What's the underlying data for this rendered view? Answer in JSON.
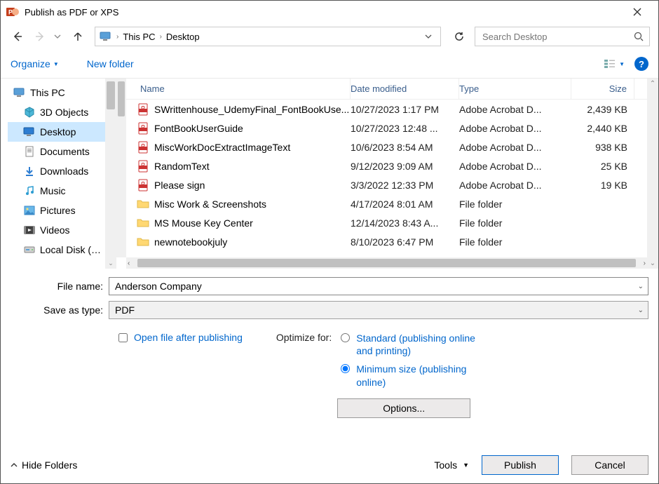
{
  "title": "Publish as PDF or XPS",
  "breadcrumb": {
    "root": "This PC",
    "folder": "Desktop"
  },
  "search": {
    "placeholder": "Search Desktop"
  },
  "toolbar": {
    "organize": "Organize",
    "newfolder": "New folder"
  },
  "sidebar": {
    "items": [
      {
        "label": "This PC",
        "icon": "pc"
      },
      {
        "label": "3D Objects",
        "icon": "3d"
      },
      {
        "label": "Desktop",
        "icon": "desktop",
        "selected": true
      },
      {
        "label": "Documents",
        "icon": "doc"
      },
      {
        "label": "Downloads",
        "icon": "down"
      },
      {
        "label": "Music",
        "icon": "music"
      },
      {
        "label": "Pictures",
        "icon": "pic"
      },
      {
        "label": "Videos",
        "icon": "vid"
      },
      {
        "label": "Local Disk (C:)",
        "icon": "disk"
      }
    ]
  },
  "columns": {
    "name": "Name",
    "date": "Date modified",
    "type": "Type",
    "size": "Size"
  },
  "files": [
    {
      "icon": "pdf",
      "name": "SWrittenhouse_UdemyFinal_FontBookUse...",
      "date": "10/27/2023 1:17 PM",
      "type": "Adobe Acrobat D...",
      "size": "2,439 KB"
    },
    {
      "icon": "pdf",
      "name": "FontBookUserGuide",
      "date": "10/27/2023 12:48 ...",
      "type": "Adobe Acrobat D...",
      "size": "2,440 KB"
    },
    {
      "icon": "pdf",
      "name": "MiscWorkDocExtractImageText",
      "date": "10/6/2023 8:54 AM",
      "type": "Adobe Acrobat D...",
      "size": "938 KB"
    },
    {
      "icon": "pdf",
      "name": "RandomText",
      "date": "9/12/2023 9:09 AM",
      "type": "Adobe Acrobat D...",
      "size": "25 KB"
    },
    {
      "icon": "pdf",
      "name": "Please sign",
      "date": "3/3/2022 12:33 PM",
      "type": "Adobe Acrobat D...",
      "size": "19 KB"
    },
    {
      "icon": "folder",
      "name": "Misc Work & Screenshots",
      "date": "4/17/2024 8:01 AM",
      "type": "File folder",
      "size": ""
    },
    {
      "icon": "folder",
      "name": "MS Mouse Key Center",
      "date": "12/14/2023 8:43 A...",
      "type": "File folder",
      "size": ""
    },
    {
      "icon": "folder",
      "name": "newnotebookjuly",
      "date": "8/10/2023 6:47 PM",
      "type": "File folder",
      "size": ""
    }
  ],
  "form": {
    "filename_label": "File name:",
    "filename_value": "Anderson Company",
    "saveas_label": "Save as type:",
    "saveas_value": "PDF",
    "open_after": "Open file after publishing",
    "optimize_label": "Optimize for:",
    "opt_standard": "Standard (publishing online and printing)",
    "opt_minimum": "Minimum size (publishing online)",
    "options_btn": "Options..."
  },
  "bottom": {
    "hide": "Hide Folders",
    "tools": "Tools",
    "publish": "Publish",
    "cancel": "Cancel"
  }
}
